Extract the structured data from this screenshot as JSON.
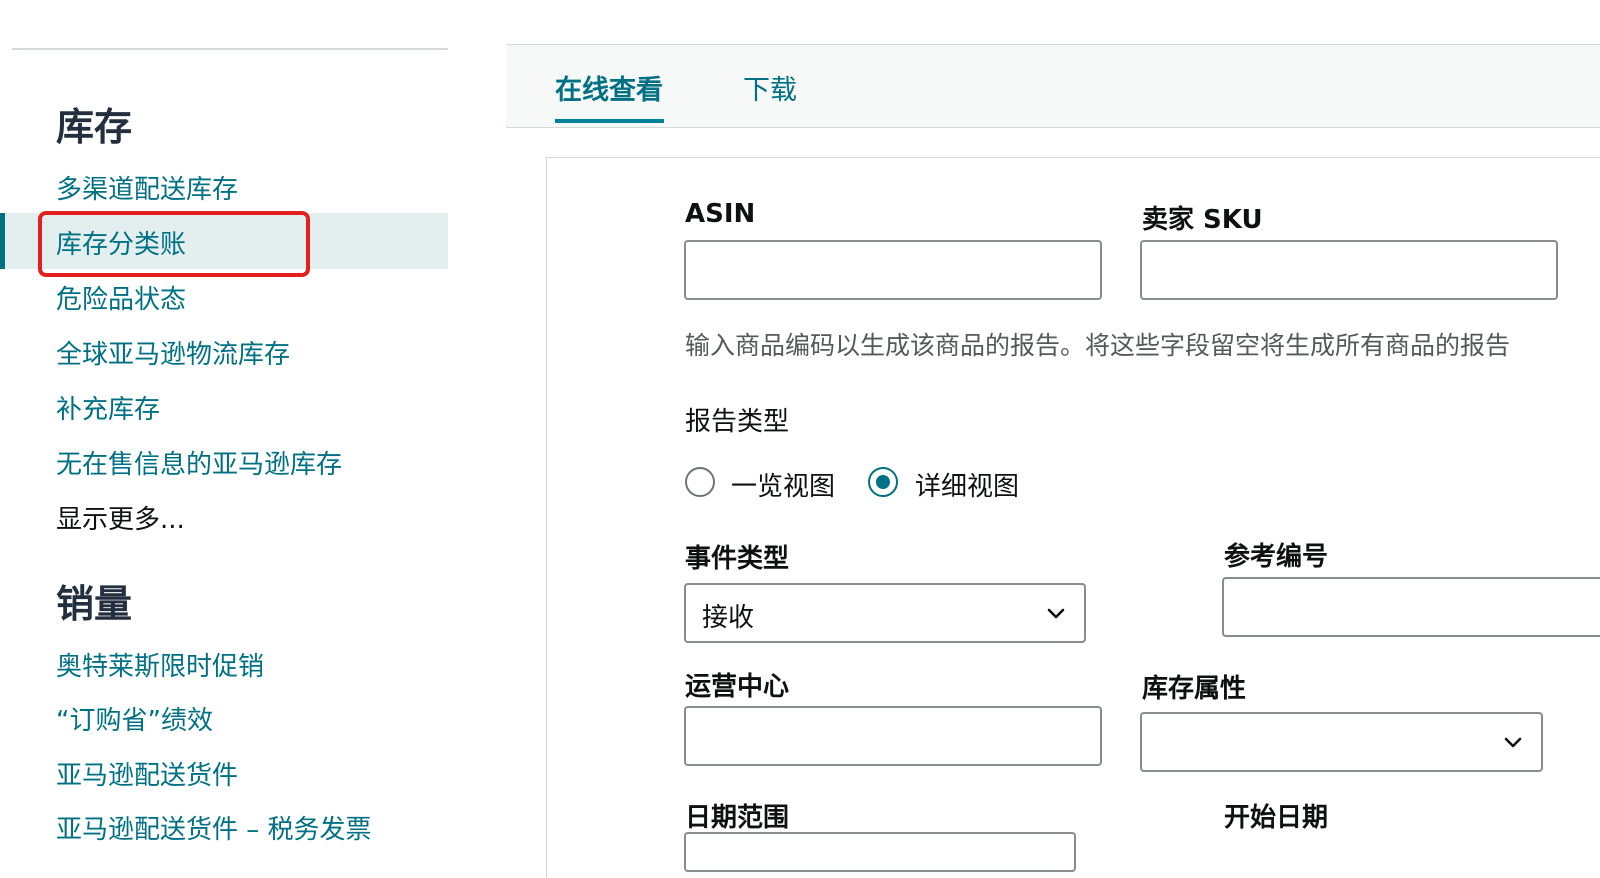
{
  "sidebar": {
    "inventory_heading": "库存",
    "inventory_items": [
      {
        "label": "多渠道配送库存"
      },
      {
        "label": "库存分类账"
      },
      {
        "label": "危险品状态"
      },
      {
        "label": "全球亚马逊物流库存"
      },
      {
        "label": "补充库存"
      },
      {
        "label": "无在售信息的亚马逊库存"
      }
    ],
    "show_more": "显示更多...",
    "sales_heading": "销量",
    "sales_items": [
      {
        "label": "奥特莱斯限时促销"
      },
      {
        "label": "“订购省”绩效"
      },
      {
        "label": "亚马逊配送货件"
      },
      {
        "label": "亚马逊配送货件 – 税务发票"
      }
    ]
  },
  "tabs": [
    {
      "label": "在线查看",
      "active": true
    },
    {
      "label": "下载",
      "active": false
    }
  ],
  "form": {
    "asin_label": "ASIN",
    "seller_sku_label": "卖家 SKU",
    "hint": "输入商品编码以生成该商品的报告。将这些字段留空将生成所有商品的报告",
    "report_type_label": "报告类型",
    "report_type_options": [
      {
        "label": "一览视图",
        "checked": false
      },
      {
        "label": "详细视图",
        "checked": true
      }
    ],
    "event_type_label": "事件类型",
    "event_type_value": "接收",
    "reference_id_label": "参考编号",
    "fulfillment_center_label": "运营中心",
    "inventory_attribute_label": "库存属性",
    "inventory_attribute_value": "",
    "date_range_label": "日期范围",
    "start_date_label": "开始日期"
  },
  "colors": {
    "link": "#007185",
    "selected_bg": "#e3eeee",
    "highlight": "#e3201e",
    "tab_underline": "#008296"
  },
  "icons": {
    "select_arrow": "chevron-down-icon"
  }
}
